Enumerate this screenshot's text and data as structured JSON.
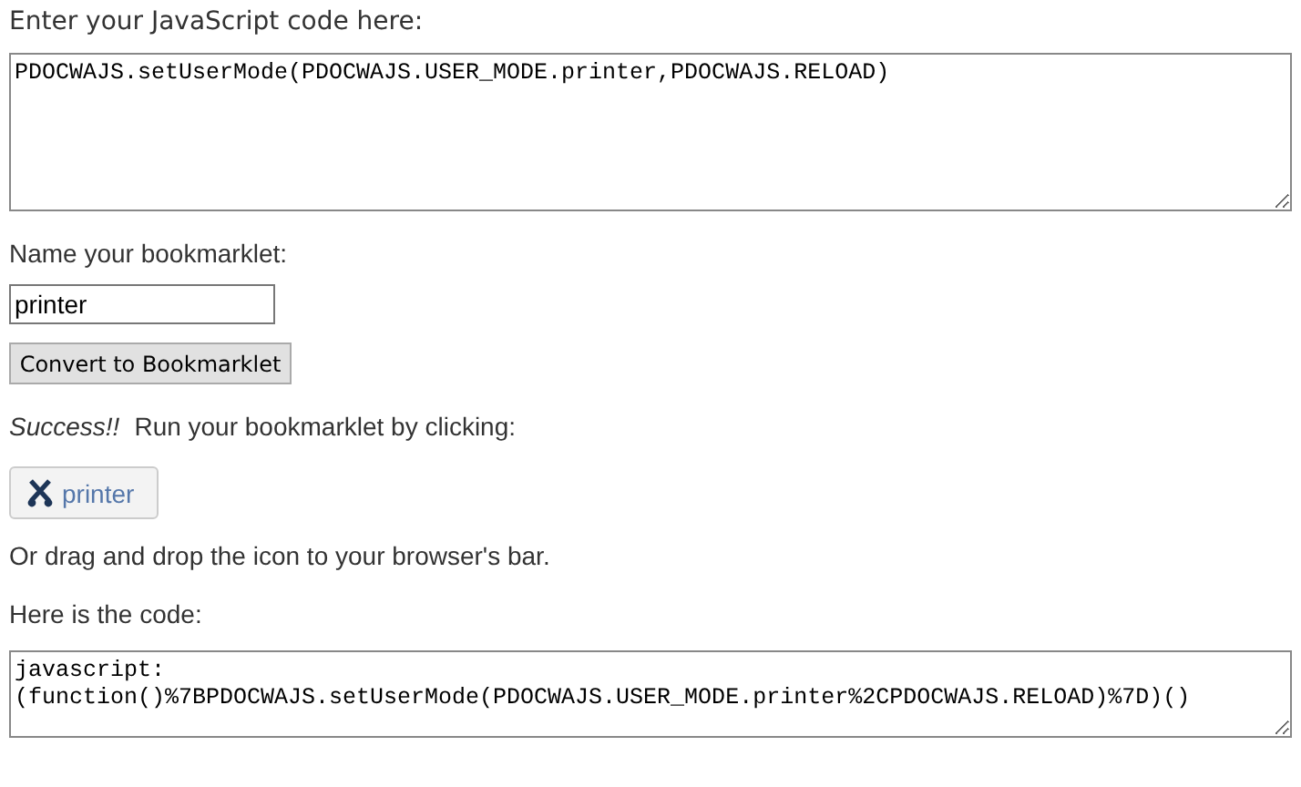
{
  "code_label": "Enter your JavaScript code here:",
  "code_input": {
    "value": "PDOCWAJS.setUserMode(PDOCWAJS.USER_MODE.printer,PDOCWAJS.RELOAD)"
  },
  "name_label": "Name your bookmarklet:",
  "name_input": {
    "value": "printer"
  },
  "convert_button": "Convert to Bookmarklet",
  "success": {
    "emphasis": "Success!!",
    "message": "Run your bookmarklet by clicking:"
  },
  "bookmarklet": {
    "label": "printer"
  },
  "drag_hint": "Or drag and drop the icon to your browser's bar.",
  "output_label": "Here is the code:",
  "output_code": {
    "lines": [
      "javascript:",
      "(function()%7BPDOCWAJS.setUserMode(PDOCWAJS.USER_MODE.printer%2CPDOCWAJS.RELOAD)%7D)()"
    ]
  }
}
